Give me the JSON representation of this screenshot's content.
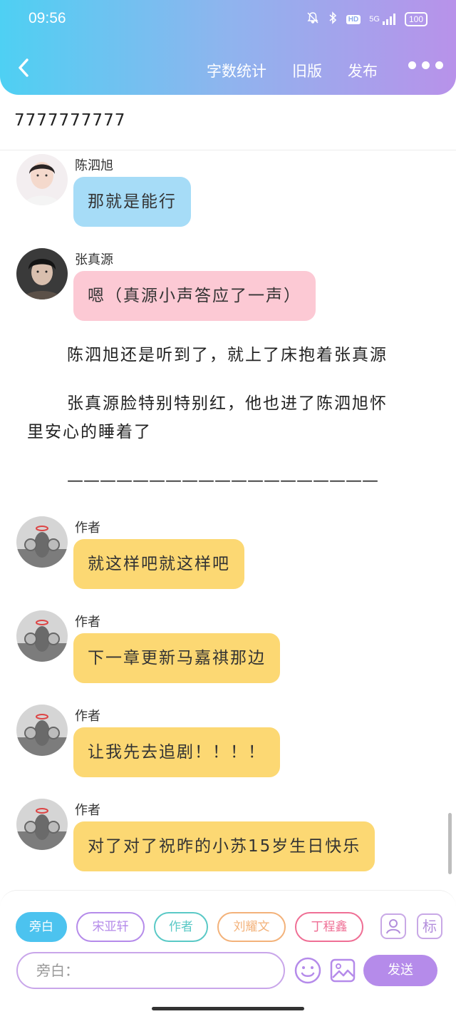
{
  "status_bar": {
    "time": "09:56",
    "hd": "HD",
    "network": "5G",
    "battery": "100"
  },
  "header": {
    "actions": [
      "字数统计",
      "旧版",
      "发布"
    ]
  },
  "story": {
    "title": "7777777777"
  },
  "messages": [
    {
      "sender": "陈泗旭",
      "text": "那就是能行",
      "bubble_color": "#a6dcf7",
      "avatar": "boy-light"
    },
    {
      "sender": "张真源",
      "text": "嗯（真源小声答应了一声）",
      "bubble_color": "#fcc9d4",
      "avatar": "boy-dark"
    }
  ],
  "narration": {
    "line1": "陈泗旭还是听到了，就上了床抱着张真源",
    "line2a": "张真源脸特别特别红，他也进了陈泗旭怀",
    "line2b": "里安心的睡着了",
    "divider": "———————————————————"
  },
  "author_messages": [
    {
      "sender": "作者",
      "text": "就这样吧就这样吧"
    },
    {
      "sender": "作者",
      "text": "下一章更新马嘉祺那边"
    },
    {
      "sender": "作者",
      "text": "让我先去追剧！！！！"
    },
    {
      "sender": "作者",
      "text": "对了对了祝昨的小苏15岁生日快乐"
    }
  ],
  "colors": {
    "author_bubble": "#fcd873",
    "accent": "#b58bea",
    "header_start": "#4ed0f3",
    "header_end": "#b892ea"
  },
  "composer": {
    "chips": [
      {
        "label": "旁白",
        "color": "#4cc3ef",
        "filled": true
      },
      {
        "label": "宋亚轩",
        "color": "#b58bea",
        "filled": false
      },
      {
        "label": "作者",
        "color": "#5ac9c6",
        "filled": false
      },
      {
        "label": "刘耀文",
        "color": "#f3b27a",
        "filled": false
      },
      {
        "label": "丁程鑫",
        "color": "#ef6f95",
        "filled": false
      }
    ],
    "tag_label": "标",
    "input_placeholder": "旁白：",
    "send_label": "发送",
    "icons": [
      "person-icon",
      "tag-icon",
      "emoji-icon",
      "image-icon"
    ]
  }
}
